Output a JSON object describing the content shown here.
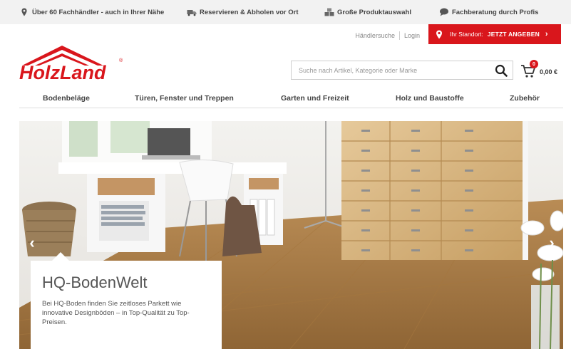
{
  "usp": [
    {
      "text": "Über 60 Fachhändler - auch in Ihrer Nähe",
      "icon": "map-pin-icon"
    },
    {
      "text": "Reservieren & Abholen vor Ort",
      "icon": "truck-icon"
    },
    {
      "text": "Große Produktauswahl",
      "icon": "boxes-icon"
    },
    {
      "text": "Fachberatung durch Profis",
      "icon": "speech-bubble-icon"
    }
  ],
  "top_links": {
    "dealer_search": "Händlersuche",
    "login": "Login"
  },
  "location": {
    "label": "Ihr Standort:",
    "cta": "JETZT ANGEBEN"
  },
  "logo": {
    "text": "HolzLand",
    "registered": "®"
  },
  "search": {
    "placeholder": "Suche nach Artikel, Kategorie oder Marke"
  },
  "cart": {
    "count": "0",
    "amount": "0,00 €"
  },
  "nav": [
    {
      "label": "Bodenbeläge"
    },
    {
      "label": "Türen, Fenster und Treppen"
    },
    {
      "label": "Garten und Freizeit"
    },
    {
      "label": "Holz und Baustoffe"
    },
    {
      "label": "Zubehör"
    }
  ],
  "hero": {
    "title": "HQ-BodenWelt",
    "text": "Bei HQ-Boden finden Sie zeitloses Parkett wie innovative Designböden – in Top-Qualität zu Top-Preisen.",
    "prev": "‹",
    "next": "›"
  },
  "colors": {
    "brand_red": "#d9161c",
    "usp_bg": "#f2f2f2"
  }
}
